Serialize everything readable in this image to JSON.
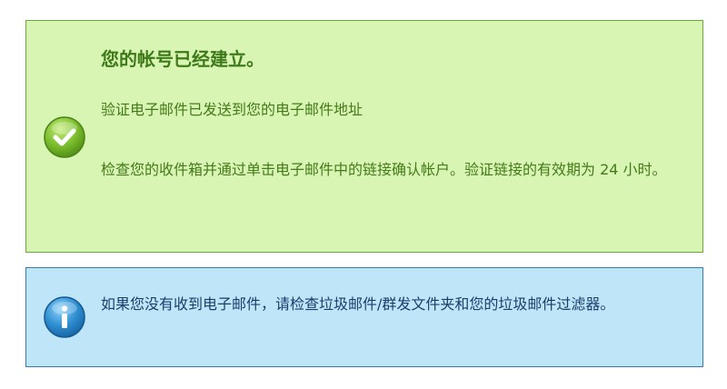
{
  "success": {
    "icon": "check-circle-icon",
    "title": "您的帐号已经建立。",
    "message_sent": "验证电子邮件已发送到您的电子邮件地址",
    "message_instructions": "检查您的收件箱并通过单击电子邮件中的链接确认帐户。验证链接的有效期为 24 小时。",
    "colors": {
      "background": "#d8f5b4",
      "border": "#6ea53e",
      "text": "#3e7a1a"
    }
  },
  "info": {
    "icon": "info-circle-icon",
    "message": "如果您没有收到电子邮件，请检查垃圾邮件/群发文件夹和您的垃圾邮件过滤器。",
    "colors": {
      "background": "#bfe5f8",
      "border": "#3978ad",
      "text": "#173f6b"
    }
  }
}
